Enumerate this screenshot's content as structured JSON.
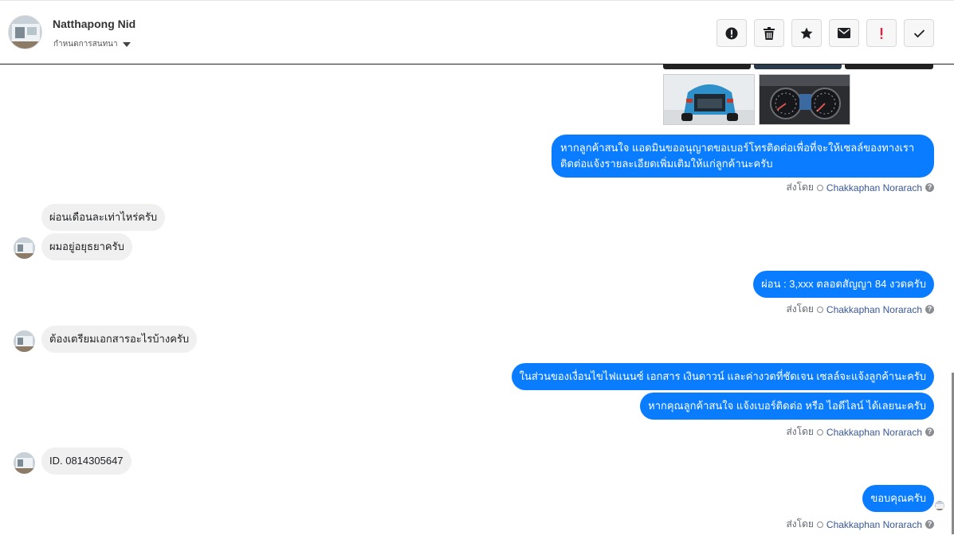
{
  "contact": {
    "name": "Natthapong Nid",
    "subtitle": "กำหนดการสนทนา"
  },
  "toolbar": {
    "buttons": [
      {
        "name": "report-spam-button",
        "icon": "exclamation-circle-icon"
      },
      {
        "name": "delete-button",
        "icon": "trash-icon"
      },
      {
        "name": "star-button",
        "icon": "star-icon"
      },
      {
        "name": "mark-unread-button",
        "icon": "envelope-icon"
      },
      {
        "name": "follow-up-button",
        "icon": "exclamation-mark-icon"
      },
      {
        "name": "mark-done-button",
        "icon": "checkmark-icon"
      }
    ]
  },
  "colors": {
    "outgoing_bubble": "#0a7cff",
    "incoming_bubble": "#f0f0f0",
    "agent_link": "#385898",
    "follow_up_red": "#e41e3f"
  },
  "messages": {
    "out1": "หากลูกค้าสนใจ แอดมินขออนุญาตขอเบอร์โทรติดต่อเพื่อที่จะให้เซลล์ของทางเราติดต่อแจ้งรายละเอียดเพิ่มเติมให้แก่ลูกค้านะครับ",
    "in1": "ผ่อนเดือนละเท่าไหร่ครับ",
    "in2": "ผมอยู่อยุธยาครับ",
    "out2": "ผ่อน : 3,xxx ตลอดสัญญา 84 งวดครับ",
    "in3": "ต้องเตรียมเอกสารอะไรบ้างครับ",
    "out3": "ในส่วนของเงื่อนไขไฟแนนซ์ เอกสาร เงินดาวน์ และค่างวดที่ชัดเจน เซลล์จะแจ้งลูกค้านะครับ",
    "out4": "หากคุณลูกค้าสนใจ แจ้งเบอร์ติดต่อ หรือ ไอดีไลน์ ได้เลยนะครับ",
    "in4": "ID. 0814305647",
    "out5": "ขอบคุณครับ"
  },
  "sent_by": {
    "label": "ส่งโดย",
    "agent": "Chakkaphan Norarach"
  }
}
